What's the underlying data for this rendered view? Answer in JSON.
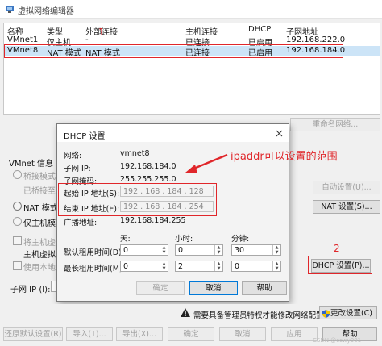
{
  "window": {
    "title": "虚拟网络编辑器"
  },
  "table": {
    "headers": [
      "名称",
      "类型",
      "外部连接",
      "主机连接",
      "DHCP",
      "子网地址"
    ],
    "rows": [
      {
        "name": "VMnet1",
        "type": "仅主机...",
        "external": "-",
        "host": "已连接",
        "dhcp": "已启用",
        "subnet": "192.168.222.0"
      },
      {
        "name": "VMnet8",
        "type": "NAT 模式",
        "external": "NAT 模式",
        "host": "已连接",
        "dhcp": "已启用",
        "subnet": "192.168.184.0"
      }
    ]
  },
  "annotations": {
    "label1": "1",
    "label2": "2",
    "ipaddr_note": "ipaddr可以设置的范围"
  },
  "main": {
    "rename_button": "重命名网络...",
    "vmnet_info": "VMnet 信息",
    "bridge_mode": "桥接模式(",
    "bridge_to": "已桥接至",
    "nat_mode": "NAT 模式(",
    "host_only": "仅主机模",
    "connect_host_adapter": "将主机虚拟",
    "host_adapter_name": "主机虚拟",
    "use_local_dhcp": "使用本地",
    "subnet_ip_label": "子网 IP (I):",
    "auto_settings": "自动设置(U)...",
    "nat_settings": "NAT 设置(S)...",
    "dhcp_settings": "DHCP 设置(P)..."
  },
  "dhcp": {
    "title": "DHCP 设置",
    "network_label": "网络:",
    "network_value": "vmnet8",
    "subnet_ip_label": "子网 IP:",
    "subnet_ip_value": "192.168.184.0",
    "mask_label": "子网掩码:",
    "mask_value": "255.255.255.0",
    "start_label": "起始 IP 地址(S):",
    "start_value": "192 . 168 . 184 . 128",
    "end_label": "结束 IP 地址(E):",
    "end_value": "192 . 168 . 184 . 254",
    "broadcast_label": "广播地址:",
    "broadcast_value": "192.168.184.255",
    "days_header": "天:",
    "hours_header": "小时:",
    "minutes_header": "分钟:",
    "default_lease_label": "默认租用时间(D):",
    "max_lease_label": "最长租用时间(M):",
    "default_days": "0",
    "default_hours": "0",
    "default_minutes": "30",
    "max_days": "0",
    "max_hours": "2",
    "max_minutes": "0",
    "ok": "确定",
    "cancel": "取消",
    "help": "帮助"
  },
  "status": {
    "message": "需要具备管理员特权才能修改网络配置。",
    "change_settings": "更改设置(C)"
  },
  "bottom": {
    "restore_defaults": "还原默认设置(R)",
    "import": "导入(T)...",
    "export": "导出(X)...",
    "ok": "确定",
    "cancel": "取消",
    "apply": "应用",
    "help": "帮助"
  },
  "watermark": "CSDN @ccwy001",
  "colors": {
    "annotation_red": "#e0262a",
    "selection": "#cce4f7"
  }
}
